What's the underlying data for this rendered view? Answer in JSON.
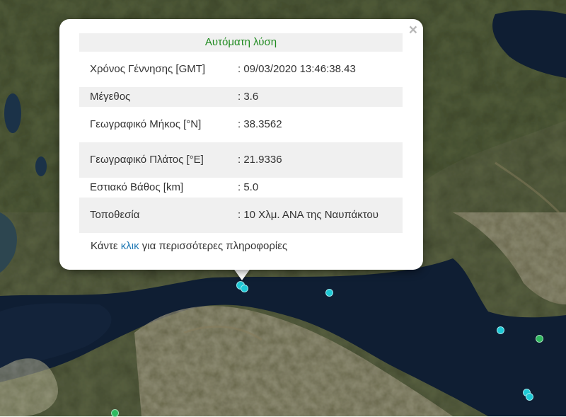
{
  "popup": {
    "title": "Αυτόματη λύση",
    "close_label": "×",
    "rows": [
      {
        "label": "Χρόνος Γέννησης [GMT]",
        "value": ": 09/03/2020 13:46:38.43"
      },
      {
        "label": "Μέγεθος",
        "value": ": 3.6"
      },
      {
        "label": "Γεωγραφικό Μήκος [°N]",
        "value": ": 38.3562"
      },
      {
        "label": "Γεωγραφικό Πλάτος [°E]",
        "value": ": 21.9336"
      },
      {
        "label": "Εστιακό Βάθος [km]",
        "value": ": 5.0"
      },
      {
        "label": "Τοποθεσία",
        "value": ": 10 Χλμ. ΑΝΑ της Ναυπάκτου"
      }
    ],
    "footer_prefix": "Κάντε",
    "footer_link": "κλικ",
    "footer_suffix": "για περισσότερες πληροφορίες"
  },
  "colors": {
    "marker_cyan": "#1ec9d6",
    "marker_green": "#2fb85f",
    "popup_title": "#1f8a1f",
    "link": "#1f78b4"
  }
}
